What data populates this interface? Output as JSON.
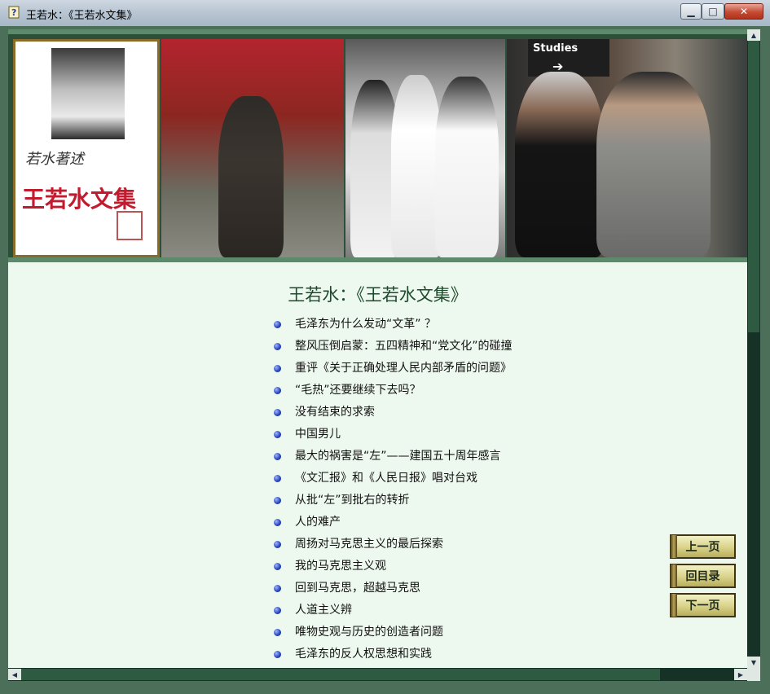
{
  "window": {
    "title": "王若水：《王若水文集》",
    "min_glyph": "▁",
    "max_glyph": "□",
    "close_glyph": "✕"
  },
  "banner": {
    "signature": "若水著述",
    "logo_text": "王若水文集",
    "sign_text": "Studies"
  },
  "page": {
    "title": "王若水：《王若水文集》"
  },
  "toc": [
    "毛泽东为什么发动“文革” ？",
    "整风压倒启蒙：五四精神和“党文化”的碰撞",
    "重评《关于正确处理人民内部矛盾的问题》",
    "“毛热”还要继续下去吗？",
    "没有结束的求索",
    "中国男儿",
    "最大的祸害是“左”——建国五十周年感言",
    "《文汇报》和《人民日报》唱对台戏",
    "从批“左”到批右的转折",
    "人的难产",
    "周扬对马克思主义的最后探索",
    "我的马克思主义观",
    "回到马克思，超越马克思",
    "人道主义辨",
    "唯物史观与历史的创造者问题",
    "毛泽东的反人权思想和实践"
  ],
  "nav": {
    "prev": "上一页",
    "contents": "回目录",
    "next": "下一页"
  },
  "colors": {
    "background": "#edf8ee",
    "title_color": "#1d4a2c",
    "bullet": "#2441b8",
    "logo_red": "#c21a2e"
  }
}
